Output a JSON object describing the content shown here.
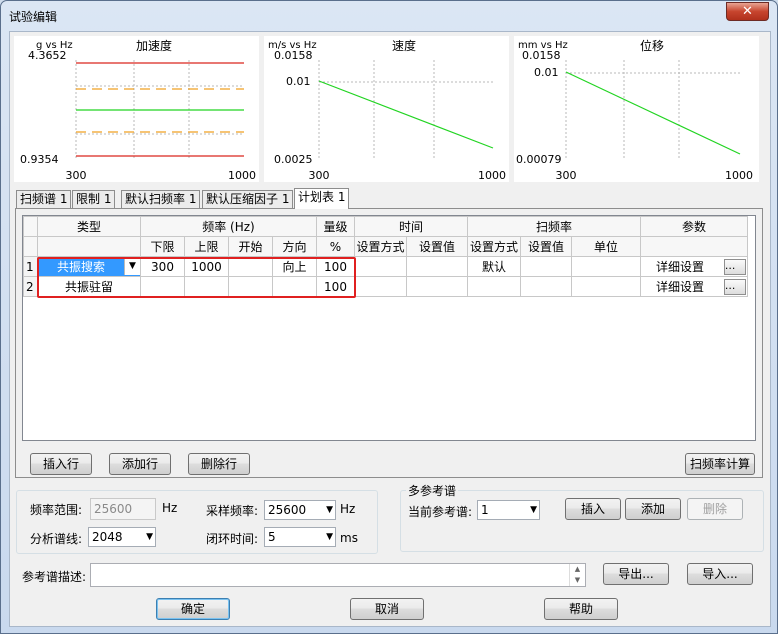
{
  "window": {
    "title": "试验编辑",
    "close_glyph": "✕"
  },
  "charts": [
    {
      "title": "加速度",
      "unit": "g vs Hz",
      "ymax": "4.3652",
      "ymin": "0.9354",
      "xmin": "300",
      "xmax": "1000"
    },
    {
      "title": "速度",
      "unit": "m/s vs Hz",
      "ymax": "0.0158",
      "ymid": "0.01",
      "ymin": "0.0025",
      "xmin": "300",
      "xmax": "1000"
    },
    {
      "title": "位移",
      "unit": "mm vs Hz",
      "ymax": "0.0158",
      "ymid": "0.01",
      "ymin": "0.00079",
      "xmin": "300",
      "xmax": "1000"
    }
  ],
  "chart_colors": {
    "red": "#d9261f",
    "orange": "#f0a020",
    "green": "#22d422"
  },
  "tabs": [
    "扫频谱 1",
    "限制 1",
    "默认扫频率 1",
    "默认压缩因子 1",
    "计划表 1"
  ],
  "table": {
    "header1": {
      "type": "类型",
      "freq": "频率 (Hz)",
      "level": "量级",
      "time": "时间",
      "sweep": "扫频率",
      "params": "参数"
    },
    "header2": {
      "lower": "下限",
      "upper": "上限",
      "start": "开始",
      "direction": "方向",
      "pct": "%",
      "time_mode": "设置方式",
      "time_value": "设置值",
      "sweep_mode": "设置方式",
      "sweep_value": "设置值",
      "sweep_unit": "单位"
    },
    "rows": [
      {
        "num": "1",
        "type": "共振搜索",
        "lower": "300",
        "upper": "1000",
        "start": "",
        "direction": "向上",
        "level": "100",
        "time_mode": "",
        "time_value": "",
        "sweep_mode": "默认",
        "sweep_value": "",
        "sweep_unit": "",
        "params": "详细设置",
        "dots": "..."
      },
      {
        "num": "2",
        "type": "共振驻留",
        "lower": "",
        "upper": "",
        "start": "",
        "direction": "",
        "level": "100",
        "time_mode": "",
        "time_value": "",
        "sweep_mode": "",
        "sweep_value": "",
        "sweep_unit": "",
        "params": "详细设置",
        "dots": "..."
      }
    ]
  },
  "buttons": {
    "insert_row": "插入行",
    "add_row": "添加行",
    "delete_row": "删除行",
    "sweep_calc": "扫频率计算",
    "insert": "插入",
    "add": "添加",
    "delete": "删除",
    "export": "导出...",
    "import": "导入...",
    "ok": "确定",
    "cancel": "取消",
    "help": "帮助"
  },
  "settings": {
    "freq_range_label": "频率范围:",
    "freq_range_value": "25600",
    "hz": "Hz",
    "sample_rate_label": "采样频率:",
    "sample_rate_value": "25600",
    "lines_label": "分析谱线:",
    "lines_value": "2048",
    "loop_time_label": "闭环时间:",
    "loop_time_value": "5",
    "ms": "ms"
  },
  "multiref": {
    "group_label": "多参考谱",
    "current_label": "当前参考谱:",
    "current_value": "1"
  },
  "ref_desc": {
    "label": "参考谱描述:",
    "value": ""
  }
}
